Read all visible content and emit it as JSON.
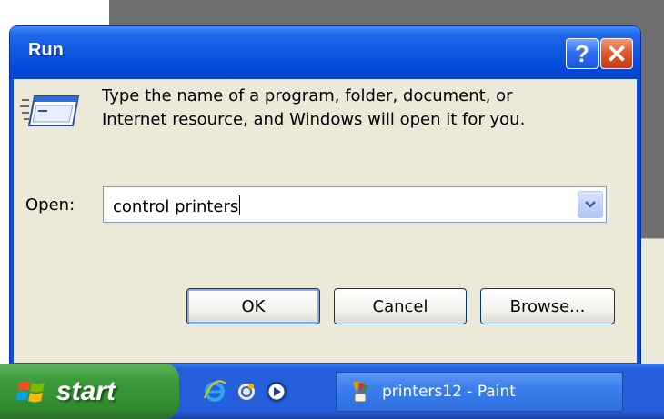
{
  "dialog": {
    "title": "Run",
    "help_glyph": "?",
    "close_glyph": "✕",
    "prompt_line1": "Type the name of a program, folder, document, or",
    "prompt_line2": "Internet resource, and Windows will open it for you.",
    "open_label": "Open:",
    "open_value": "control printers",
    "buttons": {
      "ok": "OK",
      "cancel": "Cancel",
      "browse": "Browse..."
    }
  },
  "taskbar": {
    "start_label": "start",
    "quick_launch": [
      "internet-explorer-icon",
      "outlook-express-icon",
      "media-player-icon"
    ],
    "tasks": [
      {
        "label": "printers12 - Paint",
        "icon": "paint-icon"
      }
    ]
  },
  "colors": {
    "title_bar": "#0a55e2",
    "dialog_face": "#ece9d8",
    "start_green": "#3c9c3c",
    "taskbar_blue": "#245edb",
    "close_red": "#e35a2c"
  }
}
